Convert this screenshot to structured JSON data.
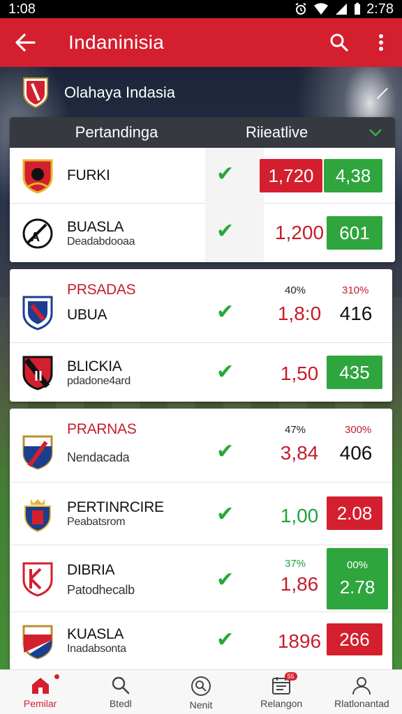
{
  "status_bar": {
    "time": "1:08",
    "clock_right": "2:78"
  },
  "app_bar": {
    "title": "Indaninisia"
  },
  "league": {
    "name": "Olahaya Indasia"
  },
  "tabs": {
    "left": "Pertandinga",
    "right": "Riieatlive"
  },
  "matches": [
    {
      "team": "FURKI",
      "sub": "",
      "odd_a": "1,720",
      "odd_b": "4,38"
    },
    {
      "team": "BUASLA",
      "sub": "Deadabdooaa",
      "odd_a": "1,200",
      "odd_b": "601"
    },
    {
      "team_top": "PRSADAS",
      "team": "UBUA",
      "pct_a": "40%",
      "pct_b": "310%",
      "odd_a": "1,8:0",
      "odd_b": "416"
    },
    {
      "team": "BLICKIA",
      "sub": "pdadone4ard",
      "odd_a": "1,50",
      "odd_b": "435"
    },
    {
      "team_top": "PRARNAS",
      "team": "Nendacada",
      "pct_a": "47%",
      "pct_b": "300%",
      "odd_a": "3,84",
      "odd_b": "406"
    },
    {
      "team": "PERTINRCIRE",
      "sub": "Peabatsrom",
      "odd_a": "1,00",
      "odd_b": "2.08"
    },
    {
      "team": "DIBRIA",
      "sub": "Patodhecalb",
      "pct_a": "37%",
      "pct_b": "00%",
      "odd_a": "1,86",
      "odd_b": "2.78"
    },
    {
      "team": "KUASLA",
      "sub": "Inadabsonta",
      "odd_a": "1896",
      "odd_b": "266"
    }
  ],
  "nav": [
    {
      "label": "Pemilar",
      "icon": "home-icon"
    },
    {
      "label": "Btedl",
      "icon": "search-icon"
    },
    {
      "label": "Nenit",
      "icon": "magnifier-circle-icon"
    },
    {
      "label": "Relangon",
      "icon": "calendar-icon",
      "badge": "55"
    },
    {
      "label": "Rlatlonantad",
      "icon": "profile-icon"
    }
  ],
  "colors": {
    "primary": "#d41f2e",
    "green": "#2fa53d",
    "dark_header": "#363a40"
  }
}
